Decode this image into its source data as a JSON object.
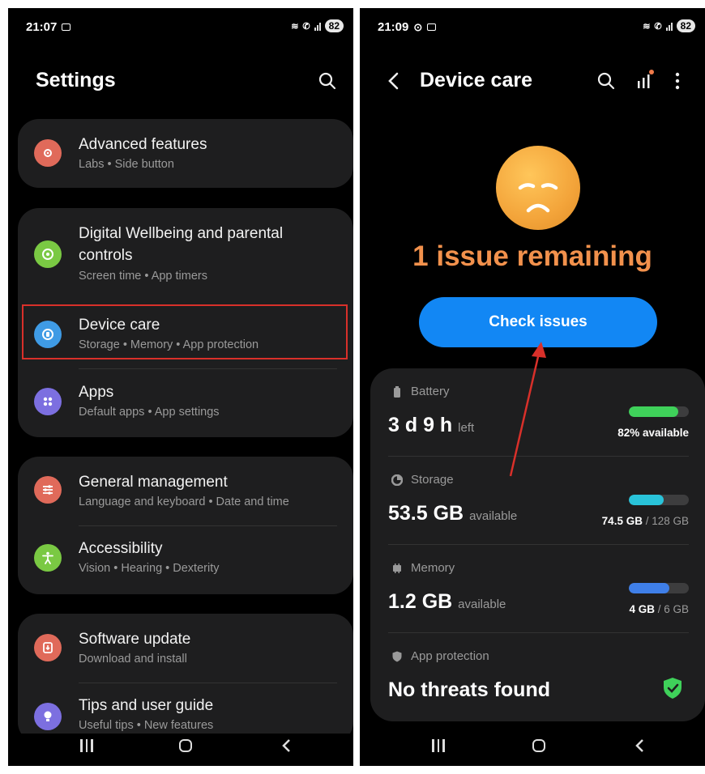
{
  "left_phone": {
    "status": {
      "time": "21:07",
      "battery": "82"
    },
    "title": "Settings",
    "groups": [
      {
        "items": [
          {
            "title": "Advanced features",
            "sub": [
              "Labs",
              "Side button"
            ],
            "color": "#e06a5a",
            "icon": "advanced-features-icon"
          }
        ]
      },
      {
        "items": [
          {
            "title": "Digital Wellbeing and parental controls",
            "sub": [
              "Screen time",
              "App timers"
            ],
            "color": "#7ac943",
            "icon": "digital-wellbeing-icon"
          },
          {
            "title": "Device care",
            "sub": [
              "Storage",
              "Memory",
              "App protection"
            ],
            "color": "#3f9be5",
            "icon": "device-care-icon"
          },
          {
            "title": "Apps",
            "sub": [
              "Default apps",
              "App settings"
            ],
            "color": "#7c6fe0",
            "icon": "apps-icon"
          }
        ]
      },
      {
        "items": [
          {
            "title": "General management",
            "sub": [
              "Language and keyboard",
              "Date and time"
            ],
            "color": "#e06a5a",
            "icon": "general-management-icon"
          },
          {
            "title": "Accessibility",
            "sub": [
              "Vision",
              "Hearing",
              "Dexterity"
            ],
            "color": "#7ac943",
            "icon": "accessibility-icon"
          }
        ]
      },
      {
        "items": [
          {
            "title": "Software update",
            "sub": [
              "Download and install"
            ],
            "color": "#e06a5a",
            "icon": "software-update-icon"
          },
          {
            "title": "Tips and user guide",
            "sub": [
              "Useful tips",
              "New features"
            ],
            "color": "#7c6fe0",
            "icon": "tips-icon"
          }
        ]
      }
    ],
    "highlight_color": "#d9302a"
  },
  "right_phone": {
    "status": {
      "time": "21:09",
      "battery": "82"
    },
    "title": "Device care",
    "issue_text": "1 issue remaining",
    "check_button": "Check issues",
    "sections": [
      {
        "label": "Battery",
        "value": "3 d 9 h",
        "unit": "left",
        "note_strong": "82% available",
        "note_dim": "",
        "fill_fraction": 0.82,
        "color": "#3fd15a",
        "icon": "battery-icon"
      },
      {
        "label": "Storage",
        "value": "53.5 GB",
        "unit": "available",
        "note_strong": "74.5 GB",
        "note_dim": " / 128 GB",
        "fill_fraction": 0.58,
        "color": "#29c3d9",
        "icon": "storage-icon"
      },
      {
        "label": "Memory",
        "value": "1.2 GB",
        "unit": "available",
        "note_strong": "4 GB",
        "note_dim": " / 6 GB",
        "fill_fraction": 0.67,
        "color": "#3f7fe8",
        "icon": "memory-icon"
      },
      {
        "label": "App protection",
        "value": "No threats found",
        "unit": "",
        "note_strong": "",
        "note_dim": "",
        "fill_fraction": null,
        "color": "#3fd15a",
        "icon": "shield-icon"
      }
    ],
    "arrow_color": "#d9302a"
  }
}
